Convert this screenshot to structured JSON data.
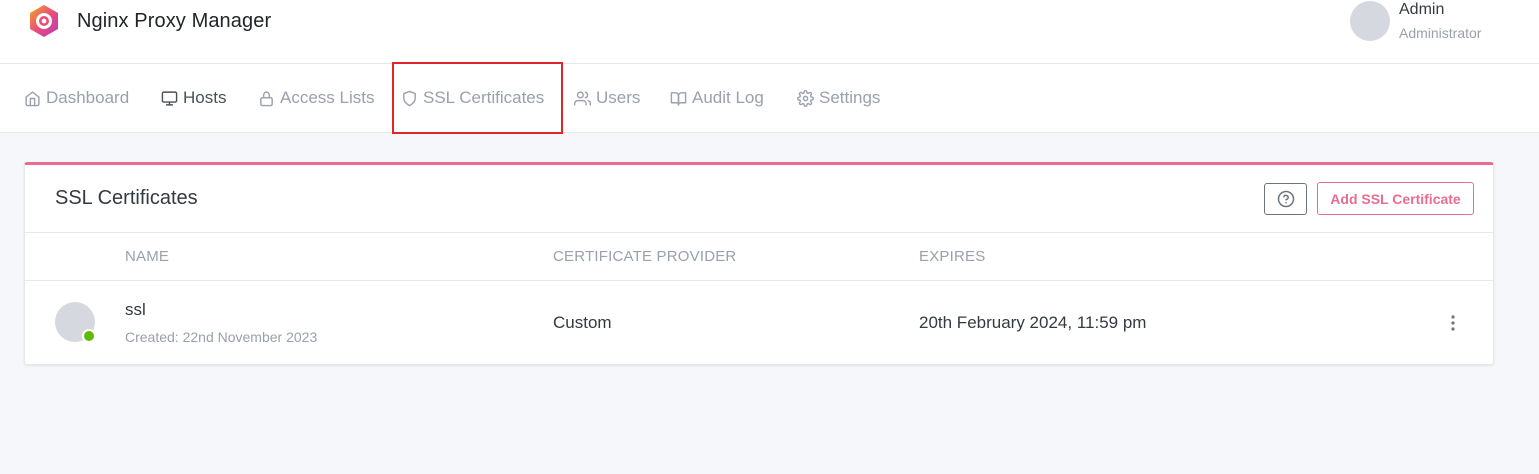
{
  "app": {
    "title": "Nginx Proxy Manager",
    "brand_colors": {
      "accent": "#e96d93",
      "highlight": "#e0262b",
      "online": "#5eba00"
    }
  },
  "user": {
    "name": "Admin",
    "role": "Administrator"
  },
  "nav": {
    "items": [
      {
        "label": "Dashboard",
        "icon": "home-icon"
      },
      {
        "label": "Hosts",
        "icon": "monitor-icon"
      },
      {
        "label": "Access Lists",
        "icon": "lock-icon"
      },
      {
        "label": "SSL Certificates",
        "icon": "shield-icon"
      },
      {
        "label": "Users",
        "icon": "users-icon"
      },
      {
        "label": "Audit Log",
        "icon": "book-open-icon"
      },
      {
        "label": "Settings",
        "icon": "gear-icon"
      }
    ]
  },
  "card": {
    "title": "SSL Certificates",
    "help_icon": "help-circle-icon",
    "add_label": "Add SSL Certificate",
    "columns": [
      "NAME",
      "CERTIFICATE PROVIDER",
      "EXPIRES"
    ],
    "rows": [
      {
        "name": "ssl",
        "created": "Created: 22nd November 2023",
        "provider": "Custom",
        "expires": "20th February 2024, 11:59 pm",
        "status": "online",
        "menu_icon": "more-vertical-icon"
      }
    ]
  }
}
